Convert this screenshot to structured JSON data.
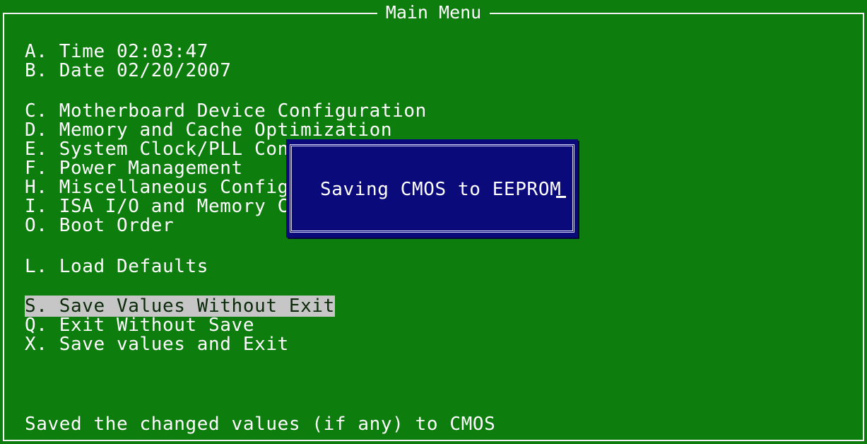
{
  "window": {
    "title": "Main Menu"
  },
  "menu": {
    "time": "A. Time 02:03:47",
    "date": "B. Date 02/20/2007",
    "items": [
      "C. Motherboard Device Configuration",
      "D. Memory and Cache Optimization",
      "E. System Clock/PLL Conf",
      "F. Power Management",
      "H. Miscellaneous Configu",
      "I. ISA I/O and Memory Co",
      "O. Boot Order"
    ],
    "load_defaults": "L. Load Defaults",
    "save_without_exit": "S. Save Values Without Exit",
    "exit_without_save": "Q. Exit Without Save",
    "save_and_exit": "X. Save values and Exit"
  },
  "dialog": {
    "message": "Saving CMOS to EEPROM"
  },
  "status": {
    "text": "Saved the changed values (if any) to CMOS"
  },
  "colors": {
    "background": "#0d7d0d",
    "dialog_background": "#0a0a7a",
    "highlight": "#c6c6c6",
    "text": "#ffffff"
  }
}
